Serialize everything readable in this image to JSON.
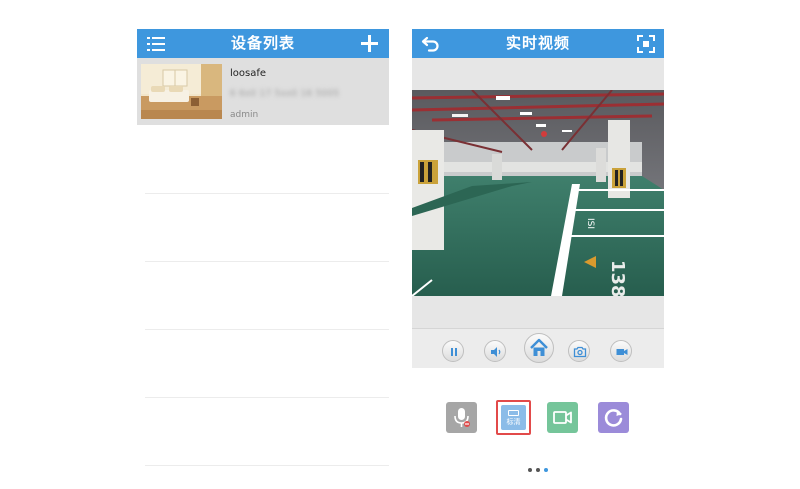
{
  "device_list": {
    "title": "设备列表",
    "devices": [
      {
        "name": "loosafe",
        "id": "6 6x0 17 5xx0 16 5005",
        "user": "admin"
      }
    ]
  },
  "live_video": {
    "title": "实时视频",
    "controls": [
      "pause-icon",
      "speaker-icon",
      "home-icon",
      "snapshot-icon",
      "record-icon"
    ],
    "functions": {
      "quality_label": "标清",
      "icons": [
        "mic-off-icon",
        "quality-icon",
        "video-record-icon",
        "rotate-icon"
      ]
    },
    "pager": {
      "count": 3,
      "active": 3
    }
  },
  "colors": {
    "header_blue": "#3e97de",
    "selected_row": "#dfdfdf",
    "floor_green": "#2f6f5c",
    "quality_border": "#e24a4a"
  }
}
